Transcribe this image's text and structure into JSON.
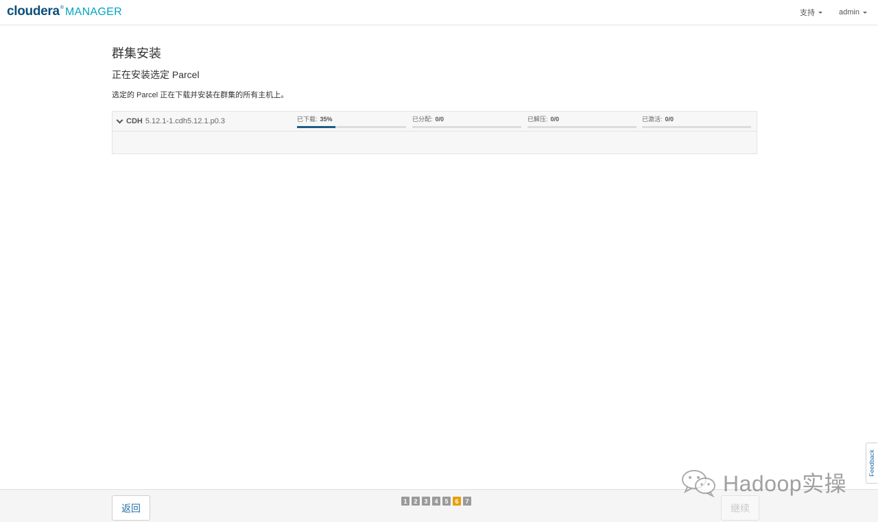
{
  "header": {
    "logo_main": "cloudera",
    "logo_reg": "®",
    "logo_sub": "MANAGER",
    "nav": [
      {
        "label": "支持"
      },
      {
        "label": "admin"
      }
    ]
  },
  "main": {
    "title": "群集安装",
    "subtitle": "正在安装选定 Parcel",
    "description": "选定的 Parcel 正在下载并安装在群集的所有主机上。"
  },
  "parcel": {
    "product": "CDH",
    "version": "5.12.1-1.cdh5.12.1.p0.3",
    "stages": [
      {
        "label": "已下载:",
        "value": "35%",
        "progress": 0.35
      },
      {
        "label": "已分配:",
        "value": "0/0",
        "progress": 0
      },
      {
        "label": "已解压:",
        "value": "0/0",
        "progress": 0
      },
      {
        "label": "已激活:",
        "value": "0/0",
        "progress": 0
      }
    ]
  },
  "footer": {
    "back_label": "返回",
    "continue_label": "继续",
    "steps": [
      "1",
      "2",
      "3",
      "4",
      "5",
      "6",
      "7"
    ],
    "active_step": "6"
  },
  "feedback_label": "Feedback",
  "watermark_text": "Hadoop实操",
  "colors": {
    "brand_dark": "#0a4f7a",
    "brand_light": "#00a3c4",
    "progress": "#1a5c87",
    "active_step": "#e8a000",
    "link": "#1f6fa8"
  }
}
